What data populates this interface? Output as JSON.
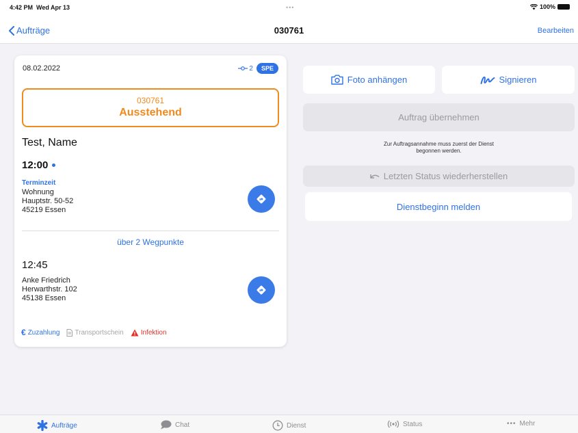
{
  "status_bar": {
    "time": "4:42 PM",
    "date": "Wed Apr 13",
    "dots": "•••",
    "battery": "100%"
  },
  "nav": {
    "back_label": "Aufträge",
    "title": "030761",
    "edit_label": "Bearbeiten"
  },
  "card": {
    "date": "08.02.2022",
    "waypoint_count": "2",
    "badge": "SPE",
    "order_number": "030761",
    "status": "Ausstehend",
    "patient_name": "Test, Name",
    "pickup_time": "12:00",
    "time_label": "Terminzeit",
    "pickup_address": [
      "Wohnung",
      "Hauptstr. 50-52",
      "45219 Essen"
    ],
    "waypoints_label": "über 2 Wegpunkte",
    "dropoff_time": "12:45",
    "dropoff_address": [
      "Anke Friedrich",
      "Herwarthstr. 102",
      "45138 Essen"
    ],
    "footer": {
      "zuzahlung": "Zuzahlung",
      "transportschein": "Transportschein",
      "infektion": "Infektion"
    }
  },
  "actions": {
    "photo": "Foto anhängen",
    "sign": "Signieren",
    "take_order": "Auftrag übernehmen",
    "hint": "Zur Auftragsannahme muss zuerst der Dienst begonnen werden.",
    "restore": "Letzten Status wiederherstellen",
    "start_service": "Dienstbeginn melden"
  },
  "tabs": [
    {
      "label": "Aufträge",
      "icon": "asterisk-icon",
      "active": true
    },
    {
      "label": "Chat",
      "icon": "chat-bubble-icon",
      "active": false
    },
    {
      "label": "Dienst",
      "icon": "clock-icon",
      "active": false
    },
    {
      "label": "Status",
      "icon": "broadcast-icon",
      "active": false
    },
    {
      "label": "Mehr",
      "icon": "more-dots-icon",
      "active": false
    }
  ],
  "colors": {
    "accent": "#2f72e4",
    "status_orange": "#f08a1c",
    "danger": "#e0302a"
  }
}
